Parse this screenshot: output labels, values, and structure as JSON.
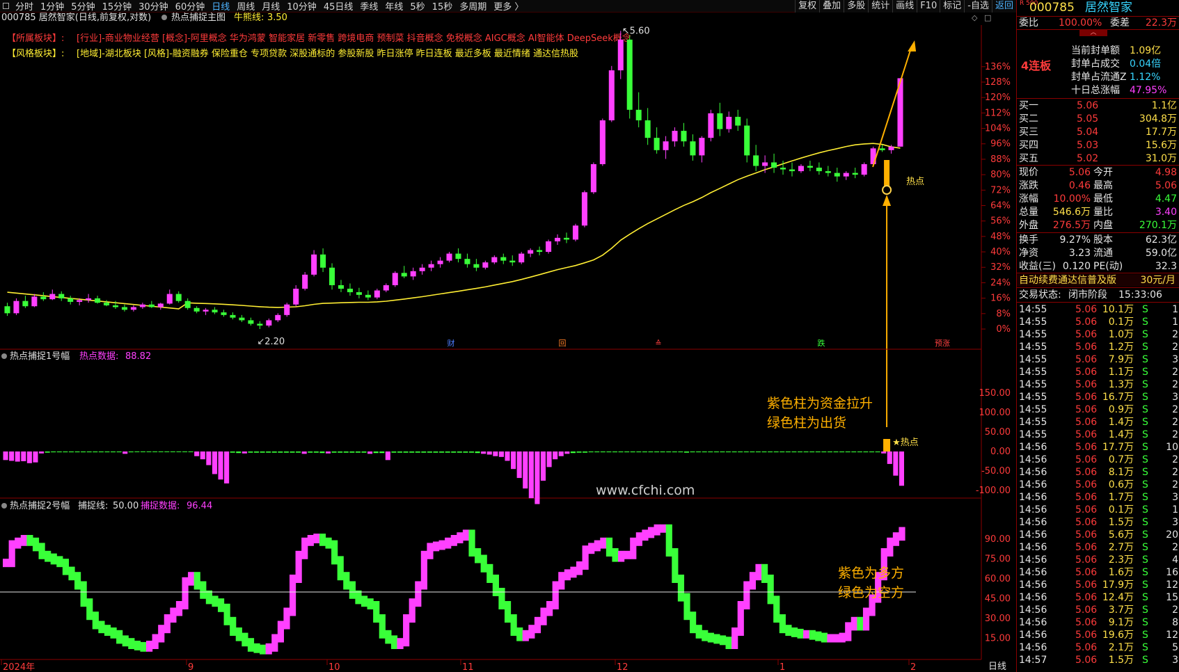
{
  "topbar": {
    "timeframes": [
      "分时",
      "1分钟",
      "5分钟",
      "15分钟",
      "30分钟",
      "60分钟",
      "日线",
      "周线",
      "月线",
      "10分钟",
      "45日线",
      "季线",
      "年线",
      "5秒",
      "15秒",
      "多周期",
      "更多 〉"
    ],
    "active": "日线",
    "right_buttons": [
      "复权",
      "叠加",
      "多股",
      "统计",
      "画线",
      "F10",
      "标记",
      "-自选",
      "返回"
    ]
  },
  "main_chart": {
    "header": "000785 居然智家(日线,前复权,对数)",
    "indicator": "热点捕捉主图",
    "bull_line_label": "牛熊线:",
    "bull_line_value": "3.50",
    "sector_label": "【所属板块】:",
    "sector_text": "[行业]-商业物业经营 [概念]-阿里概念 华为鸿蒙 智能家居 新零售 跨境电商 预制菜 抖音概念 免税概念 AIGC概念 AI智能体 DeepSeek概念",
    "style_label": "【风格板块】:",
    "style_text": "[地域]-湖北板块 [风格]-融资融券 保险重仓 专项贷款 深股通标的 参股新股 昨日涨停 昨日连板 最近多板 最近情绪 通达信热股",
    "high_label": "5.60",
    "low_label": "2.20",
    "hot_label": "热点",
    "y_ticks": [
      "136%",
      "128%",
      "120%",
      "112%",
      "104%",
      "96%",
      "88%",
      "80%",
      "72%",
      "64%",
      "56%",
      "48%",
      "40%",
      "32%",
      "24%",
      "16%",
      "8%",
      "0%"
    ],
    "event_marks": [
      {
        "text": "财",
        "color": "#4d7dff"
      },
      {
        "text": "回",
        "color": "#ff7f27"
      },
      {
        "text": "≙",
        "color": "#ff4040"
      },
      {
        "text": "跌",
        "color": "#39ff39"
      },
      {
        "text": "预涨",
        "color": "#ff4040"
      }
    ]
  },
  "sub1": {
    "title": "热点捕捉1号幅",
    "data_label": "热点数据:",
    "data_value": "88.82",
    "y_ticks": [
      "150.00",
      "100.00",
      "50.00",
      "0.00",
      "-50.00",
      "-100.00"
    ],
    "annotation_line1": "紫色柱为资金拉升",
    "annotation_line2": "绿色柱为出货",
    "hot_label": "★热点",
    "watermark": "www.cfchi.com"
  },
  "sub2": {
    "title": "热点捕捉2号幅",
    "line_label": "捕捉线:",
    "line_value": "50.00",
    "data_label": "捕捉数据:",
    "data_value": "96.44",
    "y_ticks": [
      "90.00",
      "75.00",
      "60.00",
      "45.00",
      "30.00",
      "15.00"
    ],
    "annotation_line1": "紫色为多方",
    "annotation_line2": "绿色为空方"
  },
  "xaxis": {
    "labels": [
      "2024年",
      "9",
      "10",
      "11",
      "12",
      "1",
      "2"
    ],
    "period": "日线"
  },
  "colors": {
    "up": "#ff40ff",
    "down": "#39ff39",
    "ma": "#ffee33",
    "axis": "#ff3b3b",
    "annotation": "#ffb000"
  },
  "chart_data": [
    {
      "type": "candlestick",
      "title": "000785 居然智家(日线,前复权,对数)",
      "ylim_percent": [
        0,
        136
      ],
      "ohlc": [
        [
          2.46,
          2.5,
          2.35,
          2.38
        ],
        [
          2.38,
          2.55,
          2.36,
          2.52
        ],
        [
          2.52,
          2.58,
          2.44,
          2.46
        ],
        [
          2.46,
          2.6,
          2.45,
          2.57
        ],
        [
          2.57,
          2.62,
          2.52,
          2.54
        ],
        [
          2.54,
          2.65,
          2.53,
          2.6
        ],
        [
          2.6,
          2.63,
          2.52,
          2.55
        ],
        [
          2.55,
          2.58,
          2.48,
          2.51
        ],
        [
          2.51,
          2.55,
          2.47,
          2.53
        ],
        [
          2.53,
          2.6,
          2.5,
          2.55
        ],
        [
          2.55,
          2.58,
          2.49,
          2.5
        ],
        [
          2.5,
          2.53,
          2.46,
          2.47
        ],
        [
          2.47,
          2.52,
          2.43,
          2.45
        ],
        [
          2.45,
          2.48,
          2.4,
          2.42
        ],
        [
          2.42,
          2.47,
          2.4,
          2.45
        ],
        [
          2.45,
          2.5,
          2.43,
          2.48
        ],
        [
          2.48,
          2.52,
          2.44,
          2.45
        ],
        [
          2.45,
          2.5,
          2.42,
          2.49
        ],
        [
          2.49,
          2.65,
          2.48,
          2.6
        ],
        [
          2.6,
          2.63,
          2.5,
          2.52
        ],
        [
          2.52,
          2.55,
          2.42,
          2.44
        ],
        [
          2.44,
          2.46,
          2.38,
          2.4
        ],
        [
          2.4,
          2.44,
          2.36,
          2.42
        ],
        [
          2.42,
          2.45,
          2.37,
          2.39
        ],
        [
          2.39,
          2.42,
          2.34,
          2.36
        ],
        [
          2.36,
          2.39,
          2.31,
          2.33
        ],
        [
          2.33,
          2.36,
          2.28,
          2.3
        ],
        [
          2.3,
          2.33,
          2.24,
          2.26
        ],
        [
          2.26,
          2.29,
          2.2,
          2.24
        ],
        [
          2.24,
          2.32,
          2.22,
          2.3
        ],
        [
          2.3,
          2.38,
          2.28,
          2.36
        ],
        [
          2.36,
          2.5,
          2.34,
          2.48
        ],
        [
          2.48,
          2.7,
          2.46,
          2.66
        ],
        [
          2.66,
          2.85,
          2.64,
          2.82
        ],
        [
          2.82,
          3.1,
          2.8,
          3.05
        ],
        [
          3.05,
          3.12,
          2.85,
          2.9
        ],
        [
          2.9,
          2.95,
          2.65,
          2.7
        ],
        [
          2.7,
          2.76,
          2.62,
          2.66
        ],
        [
          2.66,
          2.72,
          2.58,
          2.62
        ],
        [
          2.62,
          2.67,
          2.55,
          2.59
        ],
        [
          2.59,
          2.64,
          2.53,
          2.56
        ],
        [
          2.56,
          2.66,
          2.54,
          2.64
        ],
        [
          2.64,
          2.72,
          2.62,
          2.7
        ],
        [
          2.7,
          2.86,
          2.68,
          2.84
        ],
        [
          2.84,
          2.92,
          2.78,
          2.8
        ],
        [
          2.8,
          2.9,
          2.76,
          2.86
        ],
        [
          2.86,
          2.94,
          2.82,
          2.9
        ],
        [
          2.9,
          2.98,
          2.86,
          2.94
        ],
        [
          2.94,
          3.02,
          2.9,
          2.98
        ],
        [
          2.98,
          3.08,
          2.96,
          3.06
        ],
        [
          3.06,
          3.12,
          2.96,
          3.0
        ],
        [
          3.0,
          3.06,
          2.9,
          2.94
        ],
        [
          2.94,
          3.0,
          2.86,
          2.9
        ],
        [
          2.9,
          2.98,
          2.88,
          2.96
        ],
        [
          2.96,
          3.04,
          2.94,
          3.02
        ],
        [
          3.02,
          3.06,
          2.94,
          2.98
        ],
        [
          2.98,
          3.04,
          2.92,
          2.96
        ],
        [
          2.96,
          3.08,
          2.94,
          3.06
        ],
        [
          3.06,
          3.12,
          3.02,
          3.1
        ],
        [
          3.1,
          3.14,
          3.04,
          3.08
        ],
        [
          3.08,
          3.22,
          3.06,
          3.2
        ],
        [
          3.2,
          3.28,
          3.16,
          3.24
        ],
        [
          3.24,
          3.3,
          3.18,
          3.22
        ],
        [
          3.22,
          3.4,
          3.2,
          3.38
        ],
        [
          3.38,
          3.78,
          3.36,
          3.76
        ],
        [
          3.76,
          4.1,
          3.74,
          4.08
        ],
        [
          4.08,
          4.6,
          4.06,
          4.58
        ],
        [
          4.58,
          5.2,
          4.56,
          5.15
        ],
        [
          5.15,
          5.6,
          5.05,
          5.5
        ],
        [
          5.5,
          5.55,
          4.6,
          4.7
        ],
        [
          4.7,
          4.9,
          4.5,
          4.58
        ],
        [
          4.58,
          4.72,
          4.3,
          4.38
        ],
        [
          4.38,
          4.5,
          4.2,
          4.24
        ],
        [
          4.24,
          4.4,
          4.14,
          4.34
        ],
        [
          4.34,
          4.5,
          4.28,
          4.46
        ],
        [
          4.46,
          4.55,
          4.28,
          4.34
        ],
        [
          4.34,
          4.42,
          4.12,
          4.18
        ],
        [
          4.18,
          4.4,
          4.1,
          4.38
        ],
        [
          4.38,
          4.7,
          4.34,
          4.66
        ],
        [
          4.66,
          4.78,
          4.4,
          4.48
        ],
        [
          4.48,
          4.68,
          4.44,
          4.62
        ],
        [
          4.62,
          4.7,
          4.46,
          4.52
        ],
        [
          4.52,
          4.6,
          4.1,
          4.18
        ],
        [
          4.18,
          4.3,
          4.0,
          4.06
        ],
        [
          4.06,
          4.18,
          3.98,
          4.1
        ],
        [
          4.1,
          4.2,
          3.98,
          4.04
        ],
        [
          4.04,
          4.12,
          3.96,
          4.02
        ],
        [
          4.02,
          4.1,
          3.94,
          4.0
        ],
        [
          4.0,
          4.08,
          3.98,
          4.06
        ],
        [
          4.06,
          4.12,
          4.0,
          4.04
        ],
        [
          4.04,
          4.1,
          3.96,
          4.0
        ],
        [
          4.0,
          4.06,
          3.94,
          3.98
        ],
        [
          3.98,
          4.04,
          3.88,
          3.94
        ],
        [
          3.94,
          4.0,
          3.9,
          3.98
        ],
        [
          3.98,
          4.04,
          3.92,
          3.96
        ],
        [
          3.96,
          4.1,
          3.94,
          4.08
        ],
        [
          4.08,
          4.28,
          4.06,
          4.26
        ],
        [
          4.26,
          4.3,
          4.22,
          4.24
        ],
        [
          4.24,
          4.3,
          4.2,
          4.28
        ],
        [
          4.28,
          5.06,
          4.28,
          5.06
        ]
      ],
      "ma_label": "牛熊线",
      "ma_value": 3.5,
      "high": 5.6,
      "low": 2.2
    },
    {
      "type": "bar",
      "title": "热点捕捉1号幅",
      "ylim": [
        -150,
        180
      ],
      "values": [
        -22,
        -24,
        -26,
        -25,
        -30,
        -28,
        -5,
        -3,
        -2,
        -2,
        -2,
        -2,
        -2,
        -2,
        -2,
        -2,
        -2,
        -2,
        -2,
        -2,
        -6,
        -2,
        -1,
        -1,
        -1,
        -1,
        -1,
        -1,
        -1,
        -1,
        -1,
        -1,
        -12,
        -20,
        -35,
        -58,
        -72,
        -82,
        -3,
        -4,
        -5,
        -3,
        -3,
        -3,
        -3,
        -3,
        -3,
        -3,
        -3,
        -3,
        -6,
        -3,
        -3,
        -4,
        -5,
        -3,
        -3,
        -3,
        -3,
        -3,
        -3,
        -6,
        -4,
        -4,
        -22,
        -3,
        -3,
        -3,
        -3,
        -3,
        -3,
        -3,
        -3,
        -3,
        -3,
        -3,
        -3,
        -3,
        -3,
        -4,
        -6,
        -8,
        -12,
        -14,
        -24,
        -45,
        -68,
        -95,
        -120,
        -135,
        -75,
        -40,
        -20,
        -12,
        -6,
        -4,
        -3,
        -3,
        -2,
        -2,
        -2,
        -2,
        -2,
        -2,
        -2,
        -2,
        -2,
        -2,
        -2,
        -2,
        -2,
        -2,
        -2,
        -2,
        -3,
        -2,
        -2,
        -2,
        -2,
        -2,
        -2,
        -2,
        -2,
        -2,
        -2,
        -2,
        -2,
        -2,
        -2,
        -2,
        -2,
        -2,
        -2,
        -2,
        -2,
        -2,
        -2,
        -2,
        -2,
        -2,
        -2,
        -2,
        -2,
        -2,
        -2,
        -2,
        -2,
        -5,
        -32,
        -62,
        -88
      ]
    },
    {
      "type": "step",
      "title": "热点捕捉2号幅",
      "ylim": [
        0,
        100
      ],
      "threshold": 50.0,
      "values": [
        72,
        86,
        88,
        90,
        88,
        84,
        78,
        76,
        74,
        72,
        66,
        62,
        55,
        42,
        32,
        25,
        22,
        20,
        18,
        14,
        12,
        10,
        9,
        8,
        10,
        15,
        22,
        30,
        35,
        40,
        58,
        62,
        55,
        48,
        44,
        42,
        38,
        28,
        20,
        16,
        12,
        8,
        7,
        6,
        8,
        15,
        25,
        35,
        60,
        78,
        88,
        90,
        91,
        88,
        86,
        74,
        62,
        55,
        48,
        44,
        42,
        40,
        30,
        18,
        14,
        10,
        12,
        30,
        42,
        55,
        78,
        84,
        85,
        86,
        88,
        90,
        92,
        94,
        80,
        75,
        68,
        60,
        50,
        40,
        30,
        20,
        16,
        18,
        22,
        28,
        35,
        40,
        55,
        62,
        64,
        66,
        70,
        82,
        84,
        86,
        88,
        80,
        76,
        78,
        78,
        88,
        92,
        94,
        96,
        98,
        98,
        80,
        60,
        46,
        32,
        22,
        18,
        16,
        15,
        14,
        13,
        10,
        20,
        40,
        55,
        62,
        68,
        60,
        44,
        30,
        22,
        20,
        19,
        18,
        18,
        17,
        16,
        15,
        15,
        15,
        16,
        24,
        28,
        24,
        35,
        45,
        62,
        80,
        88,
        92,
        96
      ]
    }
  ],
  "quote": {
    "code": "000785",
    "name": "居然智家",
    "badge": "R 500",
    "weibi_label": "委比",
    "weibi": "100.00%",
    "weicha_label": "委差",
    "weicha": "22.3万",
    "limit_tag": "4连板",
    "stats": [
      {
        "label": "当前封单额",
        "value": "1.09亿",
        "color": "yellow"
      },
      {
        "label": "封单占成交",
        "value": "0.04倍",
        "color": "cyan"
      },
      {
        "label": "封单占流通Z",
        "value": "1.12%",
        "color": "cyan"
      },
      {
        "label": "十日总涨幅",
        "value": "47.95%",
        "color": "magenta"
      }
    ],
    "bids": [
      {
        "label": "买一",
        "price": "5.06",
        "vol": "1.1亿"
      },
      {
        "label": "买二",
        "price": "5.05",
        "vol": "304.8万"
      },
      {
        "label": "买三",
        "price": "5.04",
        "vol": "17.7万"
      },
      {
        "label": "买四",
        "price": "5.03",
        "vol": "15.6万"
      },
      {
        "label": "买五",
        "price": "5.02",
        "vol": "31.0万"
      }
    ],
    "info": [
      {
        "l1": "现价",
        "v1": "5.06",
        "c1": "red",
        "l2": "今开",
        "v2": "4.98",
        "c2": "red"
      },
      {
        "l1": "涨跌",
        "v1": "0.46",
        "c1": "red",
        "l2": "最高",
        "v2": "5.06",
        "c2": "red"
      },
      {
        "l1": "涨幅",
        "v1": "10.00%",
        "c1": "red",
        "l2": "最低",
        "v2": "4.47",
        "c2": "green"
      },
      {
        "l1": "总量",
        "v1": "546.6万",
        "c1": "yellow",
        "l2": "量比",
        "v2": "3.40",
        "c2": "magenta"
      },
      {
        "l1": "外盘",
        "v1": "276.5万",
        "c1": "red",
        "l2": "内盘",
        "v2": "270.1万",
        "c2": "green"
      }
    ],
    "info2": [
      {
        "l1": "换手",
        "v1": "9.27%",
        "l2": "股本",
        "v2": "62.3亿"
      },
      {
        "l1": "净资",
        "v1": "3.23",
        "l2": "流通",
        "v2": "59.0亿"
      },
      {
        "l1": "收益(三)",
        "v1": "0.120",
        "l2": "PE(动)",
        "v2": "32.3"
      }
    ],
    "ad_text": "自动续费通达信普及版",
    "ad_price": "30元/月",
    "trade_status_label": "交易状态:",
    "trade_status": "闭市阶段",
    "trade_time": "15:33:06",
    "ticks": [
      [
        "14:55",
        "5.06",
        "10.1万",
        "S",
        "1"
      ],
      [
        "14:55",
        "5.06",
        "0.1万",
        "S",
        "1"
      ],
      [
        "14:55",
        "5.06",
        "1.0万",
        "S",
        "2"
      ],
      [
        "14:55",
        "5.06",
        "1.2万",
        "S",
        "2"
      ],
      [
        "14:55",
        "5.06",
        "7.9万",
        "S",
        "3"
      ],
      [
        "14:55",
        "5.06",
        "1.1万",
        "S",
        "2"
      ],
      [
        "14:55",
        "5.06",
        "1.3万",
        "S",
        "2"
      ],
      [
        "14:55",
        "5.06",
        "16.7万",
        "S",
        "3"
      ],
      [
        "14:55",
        "5.06",
        "0.9万",
        "S",
        "2"
      ],
      [
        "14:55",
        "5.06",
        "1.4万",
        "S",
        "2"
      ],
      [
        "14:55",
        "5.06",
        "1.4万",
        "S",
        "2"
      ],
      [
        "14:56",
        "5.06",
        "17.7万",
        "S",
        "10"
      ],
      [
        "14:56",
        "5.06",
        "0.7万",
        "S",
        "2"
      ],
      [
        "14:56",
        "5.06",
        "8.1万",
        "S",
        "2"
      ],
      [
        "14:56",
        "5.06",
        "0.6万",
        "S",
        "2"
      ],
      [
        "14:56",
        "5.06",
        "1.7万",
        "S",
        "3"
      ],
      [
        "14:56",
        "5.06",
        "0.1万",
        "S",
        "1"
      ],
      [
        "14:56",
        "5.06",
        "1.5万",
        "S",
        "3"
      ],
      [
        "14:56",
        "5.06",
        "5.6万",
        "S",
        "20"
      ],
      [
        "14:56",
        "5.06",
        "2.7万",
        "S",
        "2"
      ],
      [
        "14:56",
        "5.06",
        "2.3万",
        "S",
        "4"
      ],
      [
        "14:56",
        "5.06",
        "1.6万",
        "S",
        "16"
      ],
      [
        "14:56",
        "5.06",
        "17.9万",
        "S",
        "12"
      ],
      [
        "14:56",
        "5.06",
        "12.4万",
        "S",
        "15"
      ],
      [
        "14:56",
        "5.06",
        "3.7万",
        "S",
        "2"
      ],
      [
        "14:56",
        "5.06",
        "9.1万",
        "S",
        "8"
      ],
      [
        "14:56",
        "5.06",
        "19.6万",
        "S",
        "12"
      ],
      [
        "14:56",
        "5.06",
        "2.1万",
        "S",
        "5"
      ],
      [
        "14:57",
        "5.06",
        "1.5万",
        "S",
        "3"
      ]
    ]
  }
}
